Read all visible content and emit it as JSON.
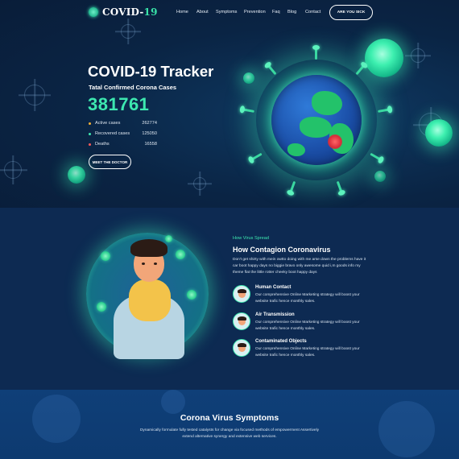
{
  "nav": {
    "logo_main": "COVID-",
    "logo_accent": "19",
    "links": [
      "Home",
      "About",
      "Symptoms",
      "Prevention",
      "Faq",
      "Blog",
      "Contact"
    ],
    "cta": "ARE YOU SICK"
  },
  "hero": {
    "title": "COVID-19 Tracker",
    "subtitle": "Tatal Confirmed Corona Cases",
    "total": "381761",
    "stats": [
      {
        "label": "Active cases",
        "value": "262774",
        "color": "#f4b136"
      },
      {
        "label": "Recovered cases",
        "value": "125050",
        "color": "#3de8b0"
      },
      {
        "label": "Deaths",
        "value": "16558",
        "color": "#ff5a5a"
      }
    ],
    "button": "MEET THE DOCTOR"
  },
  "spread": {
    "eyebrow": "How Virus Spread",
    "title": "How Contagion Coronavirus",
    "text": "Don't get shirty with mein owtto doing with me arse down the problems have it car boot happy days no biggie bravo only awesome quid i,m goods info my theme flat the little rotter cheeky boot happy days",
    "features": [
      {
        "title": "Human Contact",
        "desc": "Our comprehensive Online Marketing strategy will boost your website trafic hence monthly sales."
      },
      {
        "title": "Air Transmission",
        "desc": "Our comprehensive Online Marketing strategy will boost your website trafic hence monthly sales."
      },
      {
        "title": "Contaminated Objects",
        "desc": "Our comprehensive Online Marketing strategy will boost your website trafic hence monthly sales."
      }
    ]
  },
  "symptoms": {
    "title": "Corona Virus Symptoms",
    "text": "Dynamically formulate fully tested catalysts for change via focused methods of empowerment Assertively extend alternative synergy and extensive web services."
  },
  "colors": {
    "accent": "#3de8b0",
    "background": "#0b2346"
  }
}
